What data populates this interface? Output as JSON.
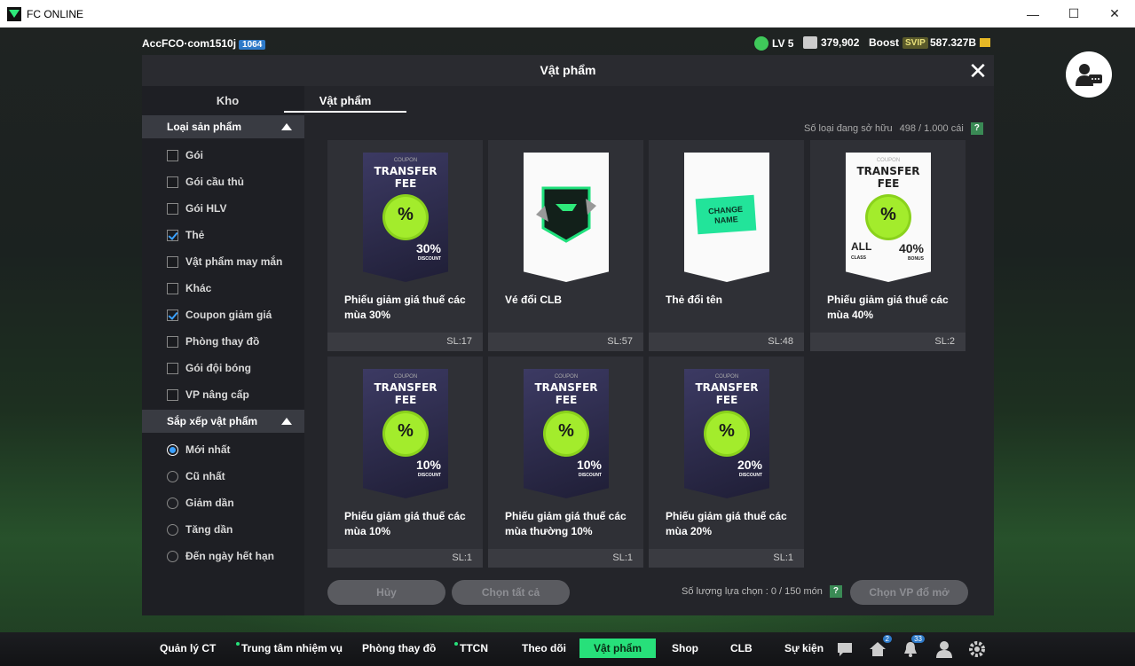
{
  "window": {
    "title": "FC ONLINE",
    "minimize": "—",
    "maximize": "☐",
    "close": "✕"
  },
  "topbar": {
    "account": "AccFCO·com1510j",
    "account_badge": "1064",
    "level": "LV 5",
    "shield_value": "379,902",
    "boost_label": "Boost",
    "svip": "SVIP",
    "balance": "587.327B"
  },
  "modal": {
    "title": "Vật phẩm",
    "close": "✕",
    "tabs": [
      "Kho",
      "Vật phẩm"
    ],
    "filter_section": "Loại sản phẩm",
    "filters": [
      {
        "label": "Gói",
        "checked": false
      },
      {
        "label": "Gói cầu thủ",
        "checked": false
      },
      {
        "label": "Gói HLV",
        "checked": false
      },
      {
        "label": "Thẻ",
        "checked": true
      },
      {
        "label": "Vật phẩm may mắn",
        "checked": false
      },
      {
        "label": "Khác",
        "checked": false
      },
      {
        "label": "Coupon giảm giá",
        "checked": true
      },
      {
        "label": "Phòng thay đồ",
        "checked": false
      },
      {
        "label": "Gói đội bóng",
        "checked": false
      },
      {
        "label": "VP nâng cấp",
        "checked": false
      }
    ],
    "sort_section": "Sắp xếp vật phẩm",
    "sorts": [
      {
        "label": "Mới nhất",
        "selected": true
      },
      {
        "label": "Cũ nhất",
        "selected": false
      },
      {
        "label": "Giảm dần",
        "selected": false
      },
      {
        "label": "Tăng dần",
        "selected": false
      },
      {
        "label": "Đến ngày hết hạn",
        "selected": false
      }
    ],
    "owned_label": "Số loại đang sở hữu",
    "owned_value": "498 / 1.000 cái",
    "help": "?",
    "items": [
      {
        "name": "Phiếu giảm giá thuế các mùa 30%",
        "qty": "SL:17",
        "kind": "coupon",
        "coupon": "COUPON",
        "fee": "TRANSFER FEE",
        "pct": "30",
        "disc": "DISCOUNT"
      },
      {
        "name": "Vé đổi CLB",
        "qty": "SL:57",
        "kind": "club"
      },
      {
        "name": "Thẻ đổi tên",
        "qty": "SL:48",
        "kind": "rename",
        "change": "CHANGE",
        "nameword": "NAME"
      },
      {
        "name": "Phiếu giảm giá thuế các mùa 40%",
        "qty": "SL:2",
        "kind": "coupon-white",
        "coupon": "COUPON",
        "fee": "TRANSFER FEE",
        "pct": "40",
        "disc": "BONUS",
        "all": "ALL",
        "classlbl": "CLASS"
      },
      {
        "name": "Phiếu giảm giá thuế các mùa 10%",
        "qty": "SL:1",
        "kind": "coupon",
        "coupon": "COUPON",
        "fee": "TRANSFER FEE",
        "pct": "10",
        "disc": "DISCOUNT"
      },
      {
        "name": "Phiếu giảm giá thuế các mùa thường 10%",
        "qty": "SL:1",
        "kind": "coupon",
        "coupon": "COUPON",
        "fee": "TRANSFER FEE",
        "pct": "10",
        "disc": "DISCOUNT"
      },
      {
        "name": "Phiếu giảm giá thuế các mùa 20%",
        "qty": "SL:1",
        "kind": "coupon",
        "coupon": "COUPON",
        "fee": "TRANSFER FEE",
        "pct": "20",
        "disc": "DISCOUNT"
      }
    ],
    "btn_cancel": "Hủy",
    "btn_select_all": "Chọn tất cả",
    "select_count": "Số lượng lựa chọn : 0 / 150 món",
    "btn_choose": "Chọn VP đổ mở"
  },
  "nav": {
    "items": [
      "Quản lý CT",
      "Trung tâm nhiệm vụ",
      "Phòng thay đồ",
      "TTCN",
      "Theo dõi",
      "Vật phẩm",
      "Shop",
      "CLB",
      "Sự kiện"
    ],
    "home_badge": "2",
    "bell_badge": "33"
  },
  "colors": {
    "accent": "#27e07a",
    "coupon_seal": "#a3ec2c",
    "check": "#3aa0ff"
  }
}
